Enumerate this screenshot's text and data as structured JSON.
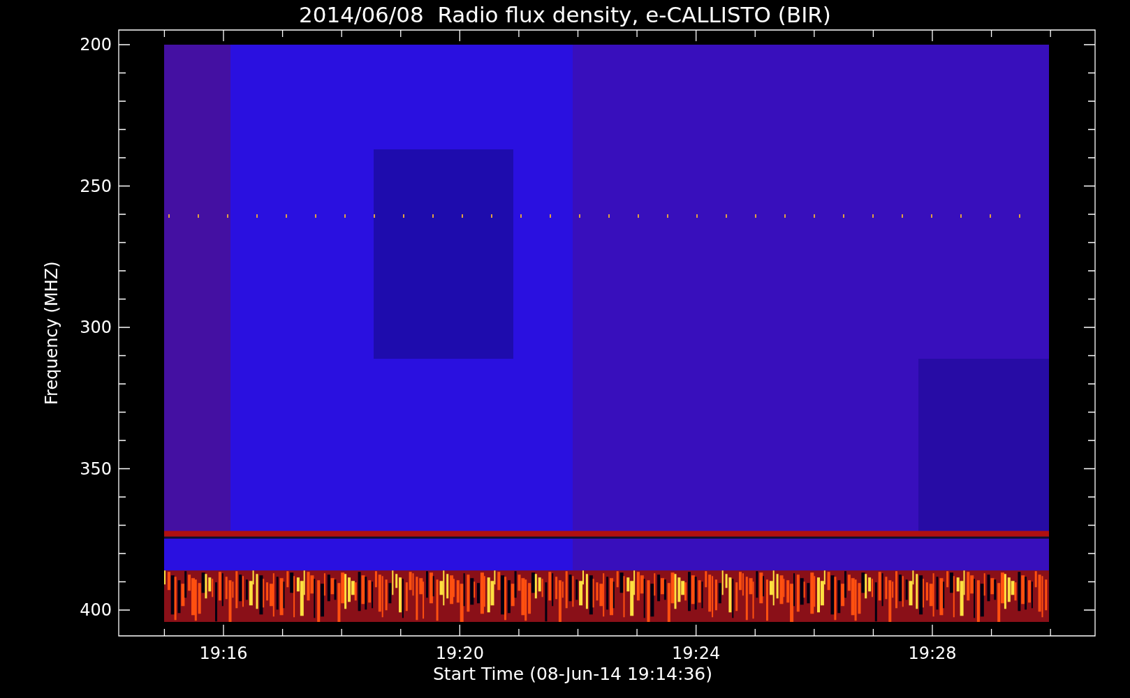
{
  "title": "2014/06/08  Radio flux density, e-CALLISTO (BIR)",
  "y_axis": {
    "label": "Frequency (MHZ)",
    "ticks": [
      "200",
      "250",
      "300",
      "350",
      "400"
    ]
  },
  "x_axis": {
    "label": "Start Time (08-Jun-14 19:14:36)",
    "ticks": [
      "19:16",
      "19:20",
      "19:24",
      "19:28"
    ]
  }
}
